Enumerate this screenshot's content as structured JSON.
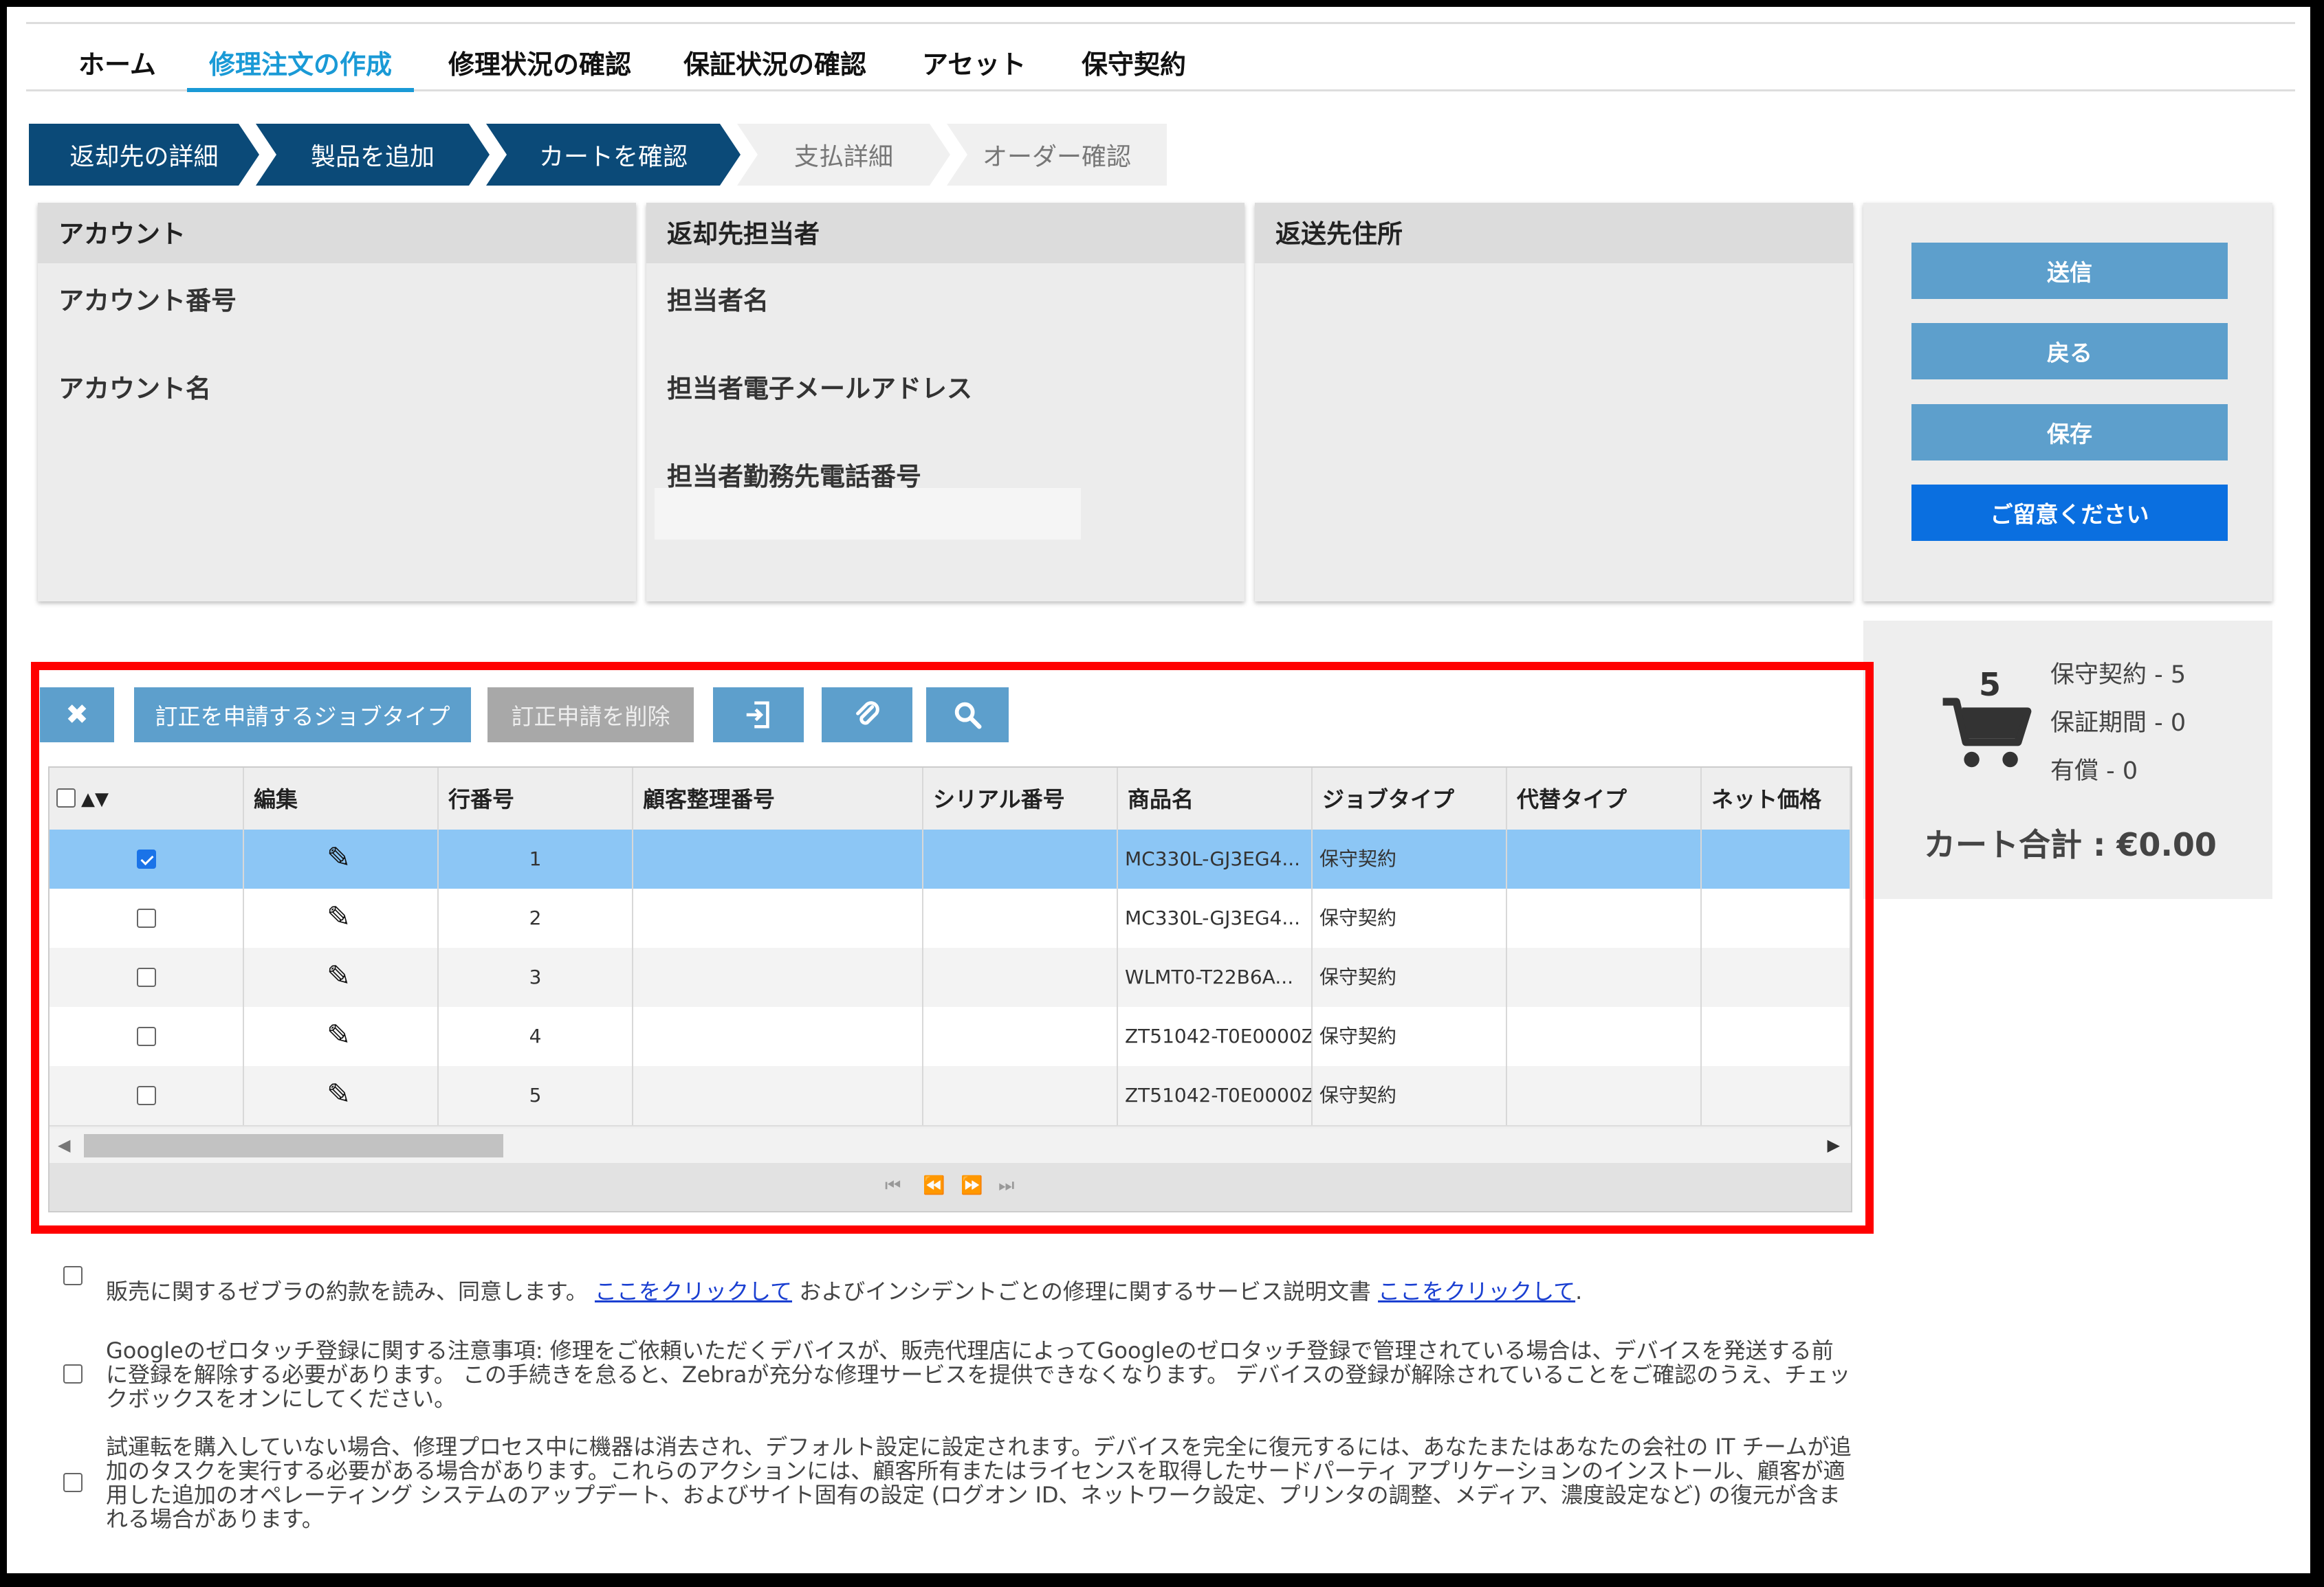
{
  "nav": {
    "tabs": [
      "ホーム",
      "修理注文の作成",
      "修理状況の確認",
      "保証状況の確認",
      "アセット",
      "保守契約"
    ],
    "active_index": 1
  },
  "steps": [
    "返却先の詳細",
    "製品を追加",
    "カートを確認",
    "支払詳細",
    "オーダー確認"
  ],
  "panels": {
    "account": {
      "title": "アカウント",
      "number_label": "アカウント番号",
      "name_label": "アカウント名"
    },
    "contact": {
      "title": "返却先担当者",
      "name_label": "担当者名",
      "email_label": "担当者電子メールアドレス",
      "phone_label": "担当者勤務先電話番号"
    },
    "address": {
      "title": "返送先住所"
    }
  },
  "actions": {
    "send": "送信",
    "back": "戻る",
    "save": "保存",
    "note": "ご留意ください"
  },
  "cart": {
    "count": "5",
    "lines": [
      "保守契約 - 5",
      "保証期間 - 0",
      "有償 - 0"
    ],
    "total": "カート合計 : €0.00"
  },
  "toolbar": {
    "close_icon": "✖",
    "request_job_type": "訂正を申請するジョブタイプ",
    "delete_request": "訂正申請を削除",
    "export_icon": "export-icon",
    "attach_icon": "paperclip-icon",
    "search_icon": "search-icon"
  },
  "grid": {
    "columns": [
      "▲▼",
      "編集",
      "行番号",
      "顧客整理番号",
      "シリアル番号",
      "商品名",
      "ジョブタイプ",
      "代替タイプ",
      "ネット価格"
    ],
    "rows": [
      {
        "checked": true,
        "line": "1",
        "customer_ref": "",
        "serial": "",
        "product": "MC330L-GJ3EG4...",
        "job_type": "保守契約",
        "alt_type": "",
        "net_price": ""
      },
      {
        "checked": false,
        "line": "2",
        "customer_ref": "",
        "serial": "",
        "product": "MC330L-GJ3EG4...",
        "job_type": "保守契約",
        "alt_type": "",
        "net_price": ""
      },
      {
        "checked": false,
        "line": "3",
        "customer_ref": "",
        "serial": "",
        "product": "WLMT0-T22B6A...",
        "job_type": "保守契約",
        "alt_type": "",
        "net_price": ""
      },
      {
        "checked": false,
        "line": "4",
        "customer_ref": "",
        "serial": "",
        "product": "ZT51042-T0E0000Z",
        "job_type": "保守契約",
        "alt_type": "",
        "net_price": ""
      },
      {
        "checked": false,
        "line": "5",
        "customer_ref": "",
        "serial": "",
        "product": "ZT51042-T0E0000Z",
        "job_type": "保守契約",
        "alt_type": "",
        "net_price": ""
      }
    ],
    "pager": [
      "⏮",
      "⏪",
      "⏩",
      "⏭"
    ]
  },
  "terms": {
    "t1_a": "販売に関するゼブラの約款を読み、同意します。",
    "t1_link1": "ここをクリックして",
    "t1_b": "およびインシデントごとの修理に関するサービス説明文書",
    "t1_link2": "ここをクリックして",
    "t1_c": ".",
    "t2": "Googleのゼロタッチ登録に関する注意事項:  修理をご依頼いただくデバイスが、販売代理店によってGoogleのゼロタッチ登録で管理されている場合は、デバイスを発送する前に登録を解除する必要があります。 この手続きを怠ると、Zebraが充分な修理サービスを提供できなくなります。 デバイスの登録が解除されていることをご確認のうえ、チェックボックスをオンにしてください。",
    "t3": "試運転を購入していない場合、修理プロセス中に機器は消去され、デフォルト設定に設定されます。デバイスを完全に復元するには、あなたまたはあなたの会社の IT チームが追加のタスクを実行する必要がある場合があります。これらのアクションには、顧客所有またはライセンスを取得したサードパーティ アプリケーションのインストール、顧客が適用した追加のオペレーティング システムのアップデート、およびサイト固有の設定 (ログオン ID、ネットワーク設定、プリンタの調整、メディア、濃度設定など) の復元が含まれる場合があります。"
  },
  "colors": {
    "brand_dark": "#0b4a78",
    "accent": "#1a9ad6",
    "button": "#5d9fcc",
    "primary": "#0a6fe0",
    "highlight": "#ff0000",
    "selected_row": "#8cc6f5"
  }
}
